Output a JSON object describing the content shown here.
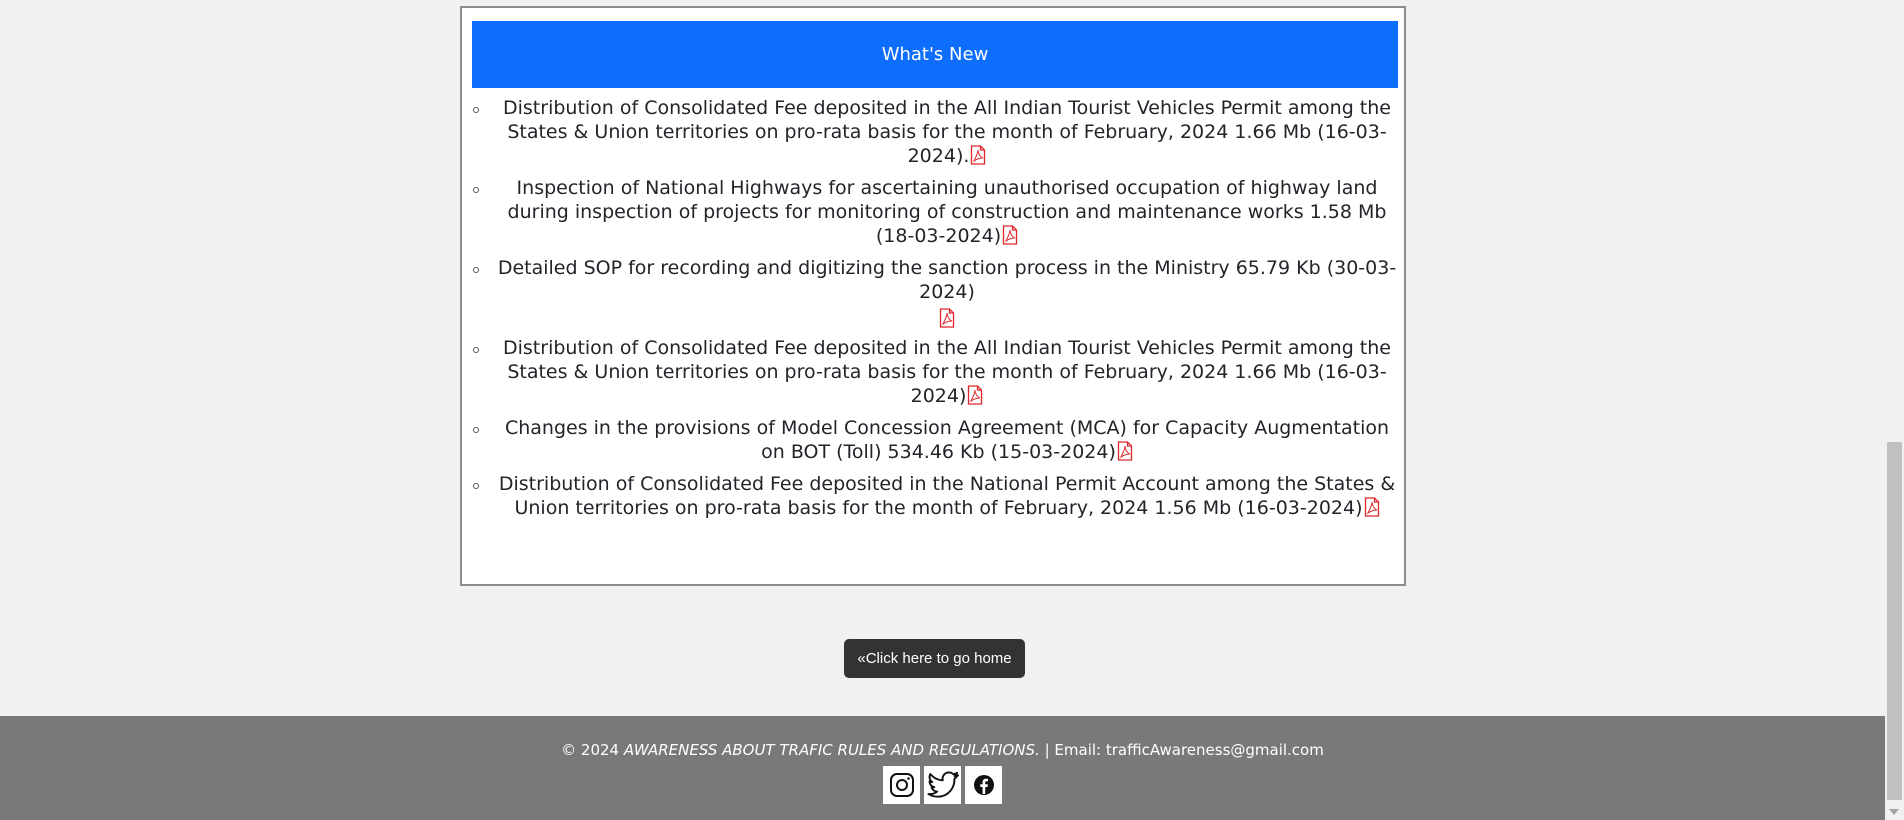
{
  "news": {
    "title": "What's New",
    "items": [
      {
        "text": "Distribution of Consolidated Fee deposited in the All Indian Tourist Vehicles Permit among the States & Union territories on pro-rata basis for the month of February, 2024 1.66 Mb (16-03-2024)."
      },
      {
        "text": "Inspection of National Highways for ascertaining unauthorised occupation of highway land during inspection of projects for monitoring of construction and maintenance works 1.58 Mb (18-03-2024)"
      },
      {
        "text": "Detailed SOP for recording and digitizing the sanction process in the Ministry 65.79 Kb (30-03-2024)"
      },
      {
        "text": "Distribution of Consolidated Fee deposited in the All Indian Tourist Vehicles Permit among the States & Union territories on pro-rata basis for the month of February, 2024 1.66 Mb (16-03-2024)"
      },
      {
        "text": "Changes in the provisions of Model Concession Agreement (MCA) for Capacity Augmentation on BOT (Toll) 534.46 Kb (15-03-2024)"
      },
      {
        "text": "Distribution of Consolidated Fee deposited in the National Permit Account among the States & Union territories on pro-rata basis for the month of February, 2024 1.56 Mb (16-03-2024)"
      }
    ]
  },
  "home_button": {
    "label": "«Click here to go home"
  },
  "footer": {
    "copyright": "© 2024",
    "org": "AWARENESS ABOUT TRAFIC RULES AND REGULATIONS.",
    "separator": "|",
    "email": "Email: trafficAwareness@gmail.com",
    "socials": [
      "instagram-icon",
      "twitter-icon",
      "facebook-icon"
    ]
  },
  "colors": {
    "header_blue": "#0d6efd",
    "pdf_red": "#e0262b",
    "footer_gray": "#7a7979",
    "button_dark": "#333333"
  }
}
